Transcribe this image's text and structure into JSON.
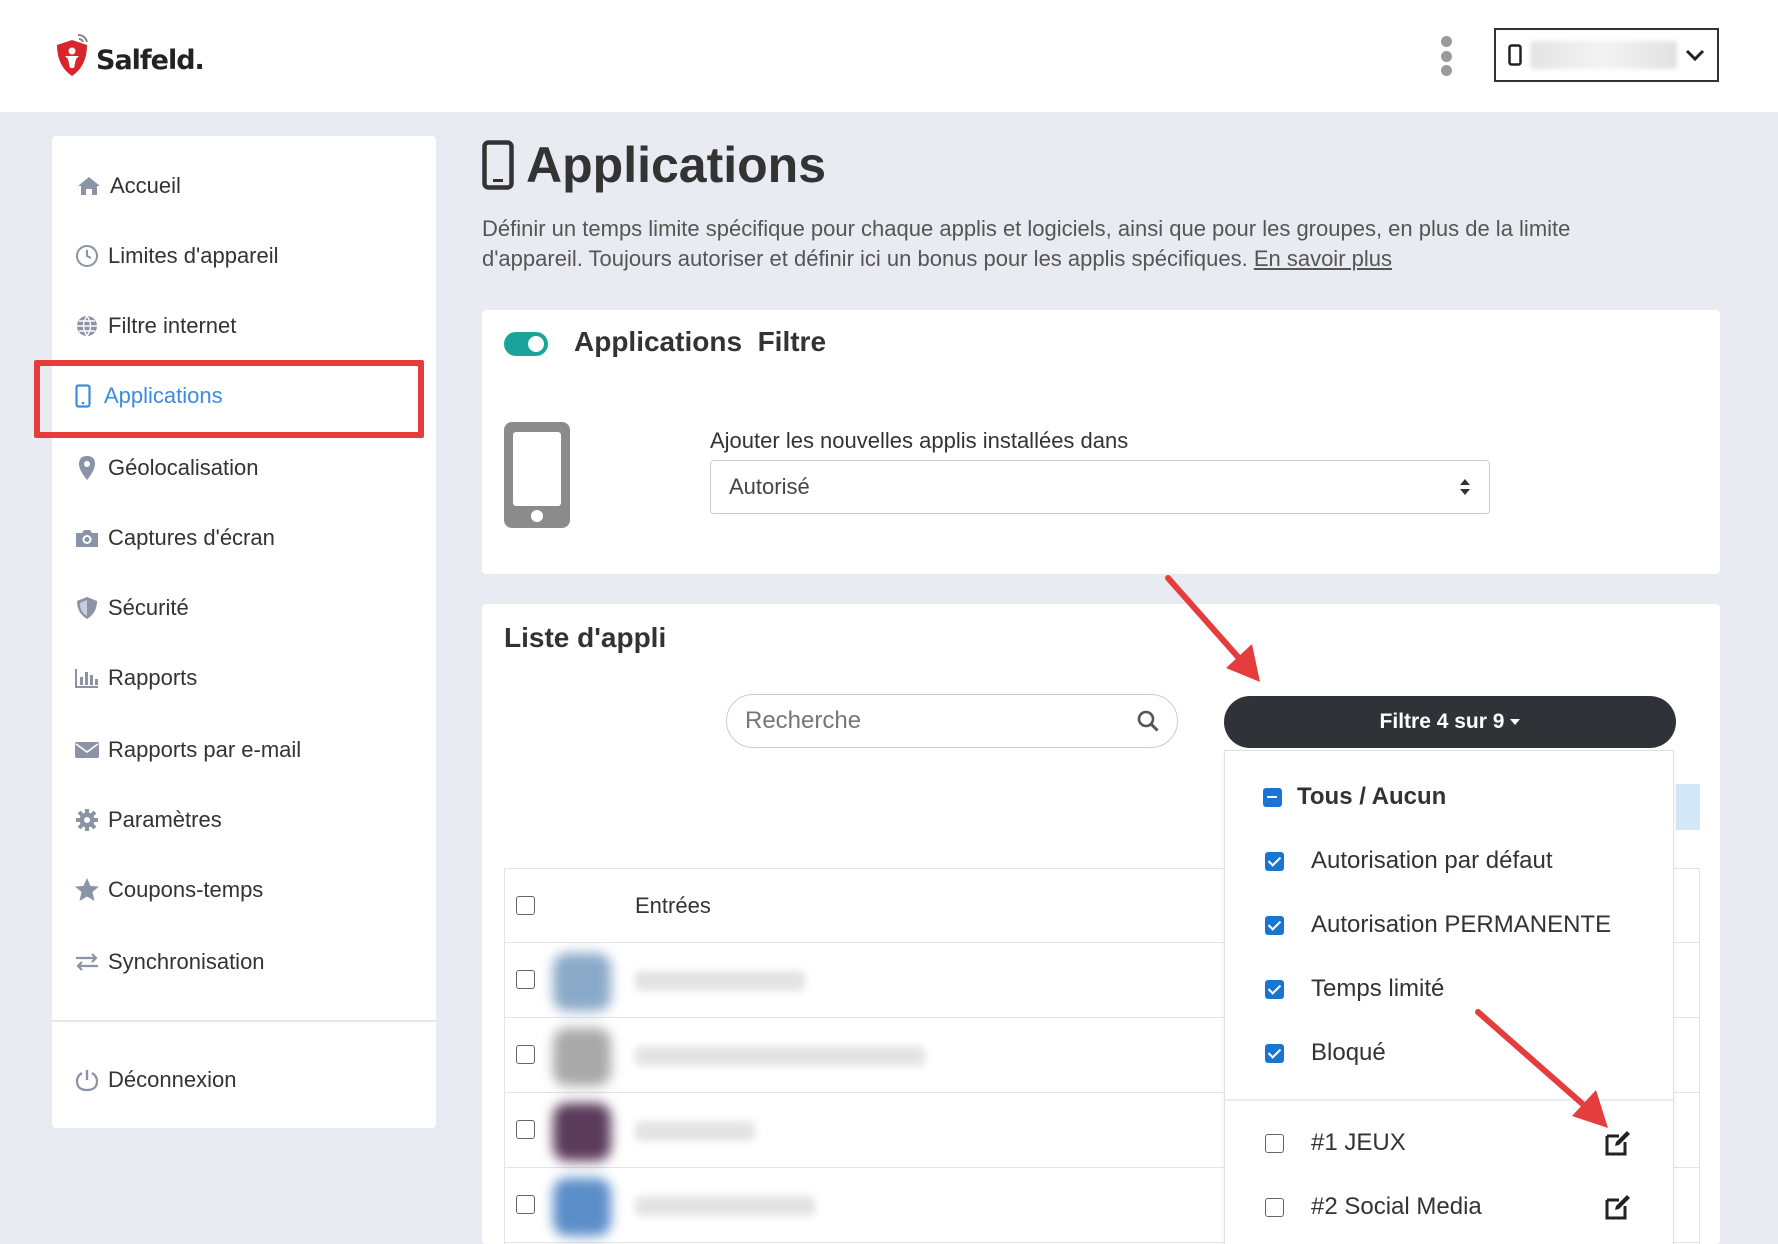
{
  "header": {
    "logo_text": "Salfeld.",
    "device_selector_value": ""
  },
  "sidebar": {
    "items": [
      {
        "label": "Accueil",
        "icon": "home-icon"
      },
      {
        "label": "Limites d'appareil",
        "icon": "clock-icon"
      },
      {
        "label": "Filtre internet",
        "icon": "globe-icon"
      },
      {
        "label": "Applications",
        "icon": "phone-icon",
        "active": true
      },
      {
        "label": "Géolocalisation",
        "icon": "map-pin-icon"
      },
      {
        "label": "Captures d'écran",
        "icon": "camera-icon"
      },
      {
        "label": "Sécurité",
        "icon": "shield-icon"
      },
      {
        "label": "Rapports",
        "icon": "bar-chart-icon"
      },
      {
        "label": "Rapports par e-mail",
        "icon": "envelope-icon"
      },
      {
        "label": "Paramètres",
        "icon": "gear-icon"
      },
      {
        "label": "Coupons-temps",
        "icon": "star-icon"
      },
      {
        "label": "Synchronisation",
        "icon": "sync-arrows-icon"
      }
    ],
    "logout": {
      "label": "Déconnexion",
      "icon": "power-icon"
    }
  },
  "main": {
    "title": "Applications",
    "description": "Définir un temps limite spécifique pour chaque applis et logiciels, ainsi que pour les groupes, en plus de la limite d'appareil. Toujours autoriser et définir ici un bonus pour les applis spécifiques.",
    "learn_more": "En savoir plus"
  },
  "filter_card": {
    "toggle_on": true,
    "title": "Applications  Filtre",
    "new_apps_label": "Ajouter les nouvelles applis installées dans",
    "new_apps_value": "Autorisé"
  },
  "list_card": {
    "title": "Liste d'appli",
    "search_placeholder": "Recherche",
    "filter_button": "Filtre 4 sur 9",
    "table_header": "Entrées",
    "rows": [
      {
        "icon_color": "#8aa9c9"
      },
      {
        "icon_color": "#a9a9a9"
      },
      {
        "icon_color": "#5a3b5a"
      },
      {
        "icon_color": "#5b8ec9"
      }
    ]
  },
  "filter_dropdown": {
    "all_none": "Tous / Aucun",
    "options": [
      {
        "label": "Autorisation par défaut",
        "checked": true
      },
      {
        "label": "Autorisation PERMANENTE",
        "checked": true
      },
      {
        "label": "Temps limité",
        "checked": true
      },
      {
        "label": "Bloqué",
        "checked": true
      }
    ],
    "groups": [
      {
        "label": "#1 JEUX",
        "checked": false
      },
      {
        "label": "#2 Social Media",
        "checked": false
      }
    ]
  },
  "colors": {
    "accent": "#3a8dde",
    "toggle": "#1aa39a",
    "filter_button": "#2f3237",
    "highlight": "#e53d3d",
    "checkbox": "#1a74d6"
  }
}
